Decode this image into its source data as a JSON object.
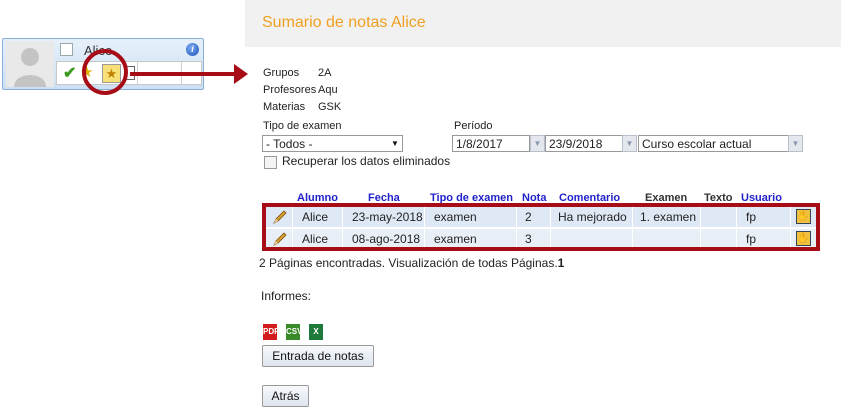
{
  "header": {
    "title": "Sumario de notas Alice"
  },
  "student_card": {
    "name": "Alice",
    "info_icon": "i",
    "tools": [
      "check-icon",
      "star-icon",
      "grade-summary-icon",
      "document-icon"
    ]
  },
  "info": {
    "groups_label": "Grupos",
    "groups_value": "2A",
    "teachers_label": "Profesores",
    "teachers_value": "Aqu",
    "subjects_label": "Materias",
    "subjects_value": "GSK"
  },
  "filters": {
    "exam_type_label": "Tipo de examen",
    "exam_type_value": "- Todos -",
    "period_label": "Período",
    "date_from": "1/8/2017",
    "date_to": "23/9/2018",
    "period_select": "Curso escolar actual",
    "recover_label": "Recuperar los datos eliminados"
  },
  "table": {
    "headers": {
      "student": "Alumno",
      "date": "Fecha",
      "exam_type": "Tipo de examen",
      "grade": "Nota",
      "comment": "Comentario",
      "exam": "Examen",
      "text": "Texto",
      "user": "Usuario"
    },
    "rows": [
      {
        "student": "Alice",
        "date": "23-may-2018",
        "exam_type": "examen",
        "grade": "2",
        "comment": "Ha mejorado",
        "exam": "1. examen",
        "text": "",
        "user": "fp"
      },
      {
        "student": "Alice",
        "date": "08-ago-2018",
        "exam_type": "examen",
        "grade": "3",
        "comment": "",
        "exam": "",
        "text": "",
        "user": "fp"
      }
    ]
  },
  "pagination": {
    "text": "2 Páginas encontradas. Visualización de todas Páginas.",
    "page": "1"
  },
  "reports": {
    "label": "Informes:",
    "pdf": "PDF",
    "csv": "CSV",
    "xls": "X"
  },
  "buttons": {
    "grade_entry": "Entrada de notas",
    "back": "Atrás"
  },
  "colors": {
    "accent_title": "#f0a020",
    "highlight": "#a80c16",
    "link_header": "#2222cc"
  }
}
